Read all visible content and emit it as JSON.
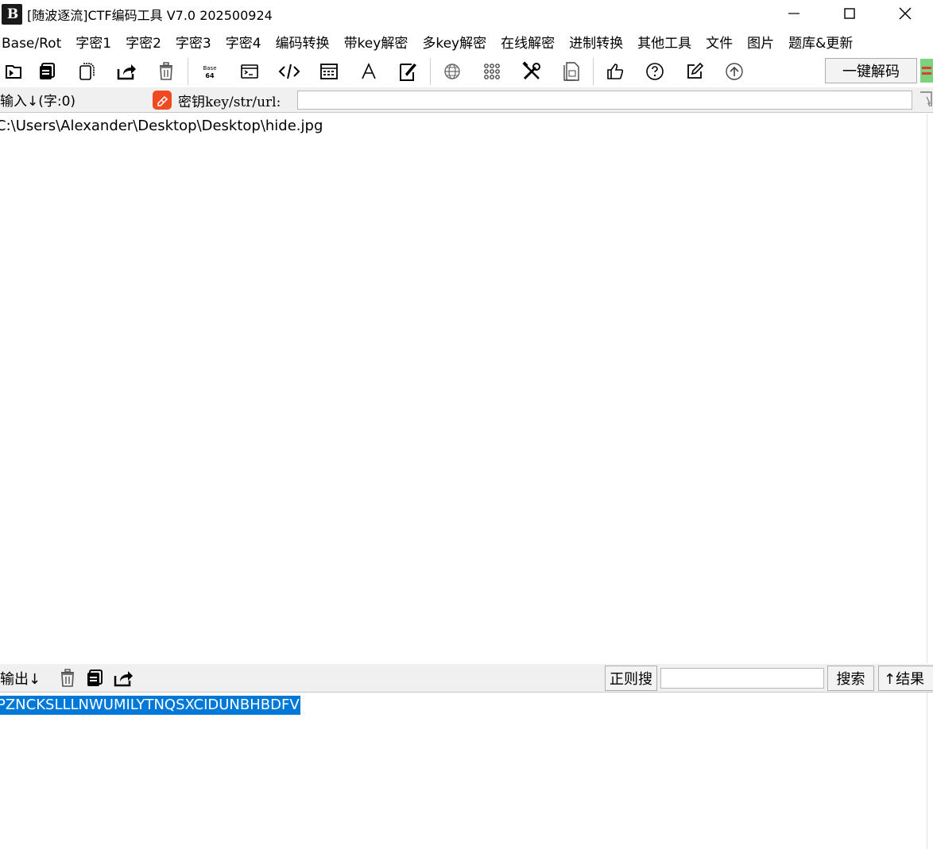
{
  "window": {
    "logo_text": "B",
    "title": "[随波逐流]CTF编码工具 V7.0  202500924"
  },
  "menu": [
    "Base/Rot",
    "字密1",
    "字密2",
    "字密3",
    "字密4",
    "编码转换",
    "带key解密",
    "多key解密",
    "在线解密",
    "进制转换",
    "其他工具",
    "文件",
    "图片",
    "题库&更新"
  ],
  "toolbar": {
    "icons": [
      "import-icon",
      "copy-icon",
      "paste-icon",
      "share-icon",
      "trash-icon",
      "base64-icon",
      "terminal-icon",
      "code-icon",
      "calculator-icon",
      "font-icon",
      "edit-frame-icon",
      "globe-icon",
      "grid-icon",
      "tools-icon",
      "document-icon",
      "thumbs-up-icon",
      "help-icon",
      "edit-icon",
      "upload-icon"
    ],
    "oneclick_label": "一键解码"
  },
  "input": {
    "label": "输入↓(字:0)",
    "key_label": "密钥key/str/url:",
    "key_value": "",
    "text": "C:\\Users\\Alexander\\Desktop\\Desktop\\hide.jpg"
  },
  "output": {
    "label": "输出↓",
    "regex_label": "正则搜",
    "search_value": "",
    "search_label": "搜索",
    "result_label": "↑结果",
    "text": "PZNCKSLLLNWUMILYTNQSXCIDUNBHBDFV"
  },
  "colors": {
    "selection": "#0078d7",
    "key_icon": "#f04a23",
    "panel_bg": "#f0f0f0"
  }
}
